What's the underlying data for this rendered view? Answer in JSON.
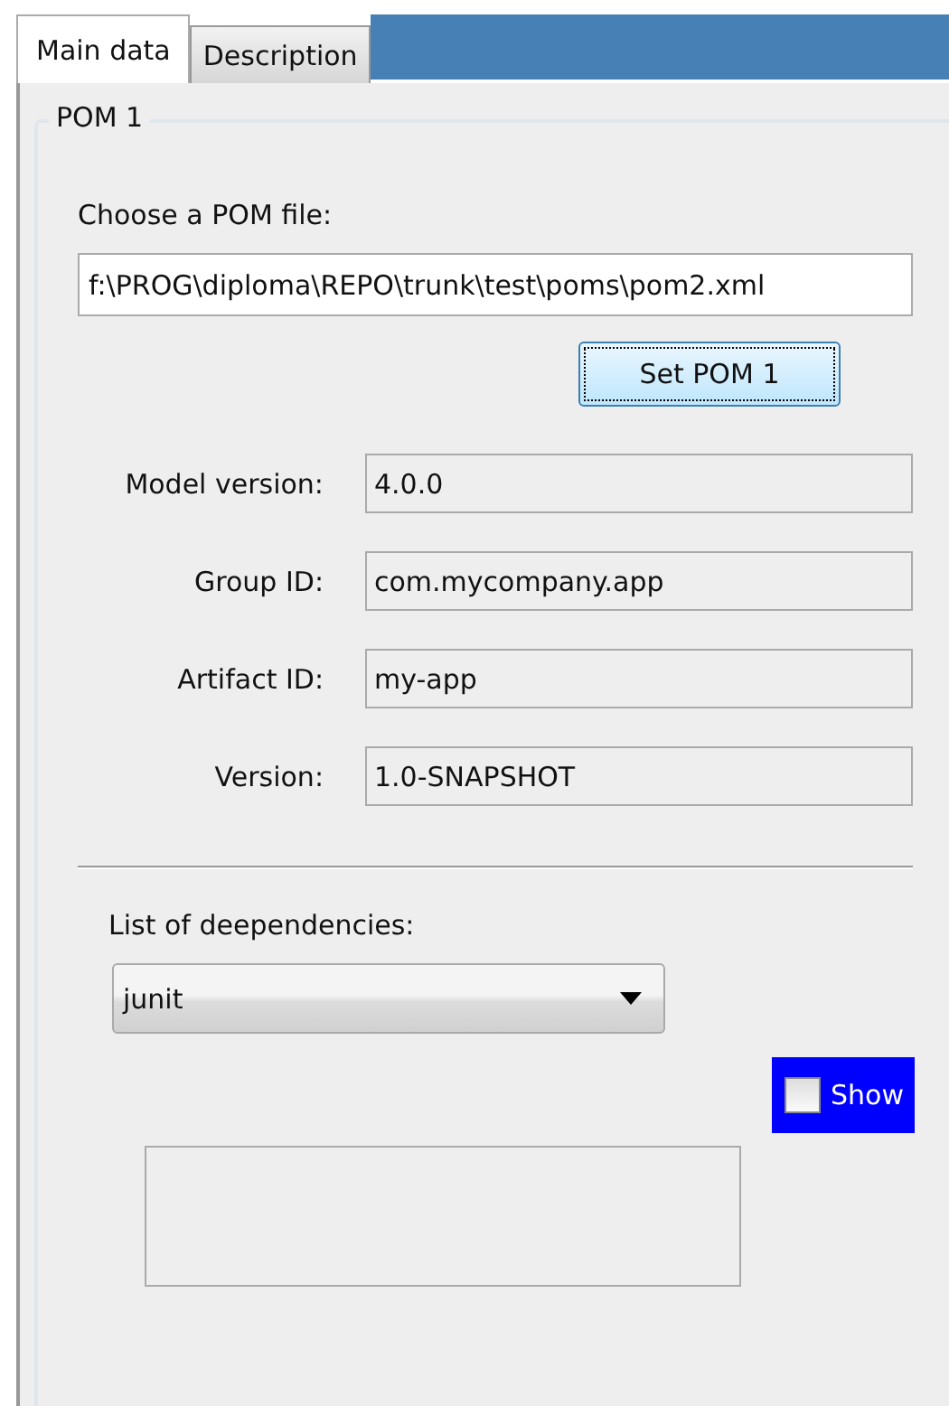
{
  "tabs": [
    {
      "label": "Main data",
      "selected": true
    },
    {
      "label": "Description",
      "selected": false
    }
  ],
  "group": {
    "title": "POM 1"
  },
  "file": {
    "label": "Choose a POM file:",
    "value": "f:\\PROG\\diploma\\REPO\\trunk\\test\\poms\\pom2.xml"
  },
  "set_button": {
    "label": "Set POM 1"
  },
  "fields": [
    {
      "label": "Model version:",
      "value": "4.0.0"
    },
    {
      "label": "Group ID:",
      "value": "com.mycompany.app"
    },
    {
      "label": "Artifact ID:",
      "value": "my-app"
    },
    {
      "label": "Version:",
      "value": "1.0-SNAPSHOT"
    }
  ],
  "dependencies": {
    "label": "List of deependencies:",
    "selected_value": "junit"
  },
  "show_checkbox": {
    "label": "Show",
    "checked": false
  }
}
